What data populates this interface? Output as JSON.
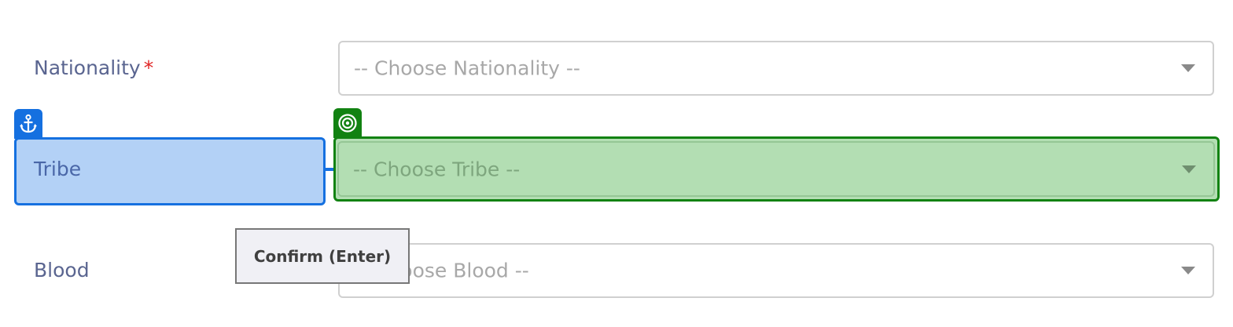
{
  "form": {
    "nationality": {
      "label": "Nationality",
      "required_marker": "*",
      "placeholder": "-- Choose Nationality --"
    },
    "tribe": {
      "label": "Tribe",
      "placeholder": "-- Choose Tribe --"
    },
    "blood": {
      "label": "Blood",
      "placeholder": "-- Choose Blood --"
    }
  },
  "overlay": {
    "anchor_icon": "anchor-icon",
    "target_icon": "target-icon",
    "anchor_color": "#1570e0",
    "target_color": "#128212",
    "tooltip_text": "Confirm (Enter)"
  }
}
